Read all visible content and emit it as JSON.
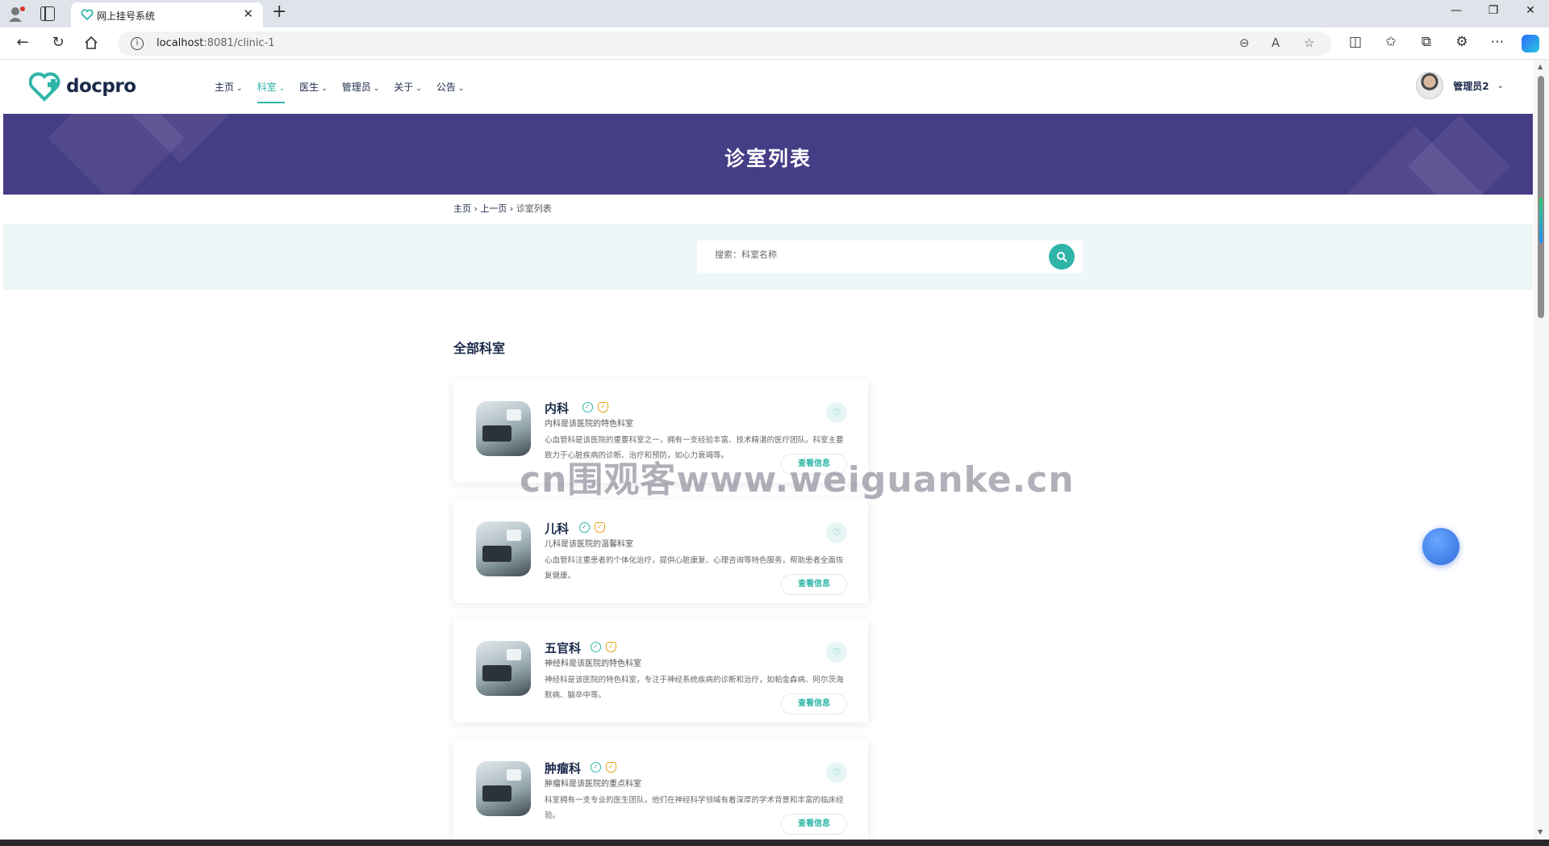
{
  "browser": {
    "tab_title": "网上挂号系统",
    "tab_close": "✕",
    "new_tab": "+",
    "url_host": "localhost",
    "url_rest": ":8081/clinic-1",
    "window_controls": [
      "—",
      "❐",
      "✕"
    ]
  },
  "header": {
    "logo_text": "docpro",
    "menu": [
      {
        "label": "主页",
        "active": false
      },
      {
        "label": "科室",
        "active": true
      },
      {
        "label": "医生",
        "active": false
      },
      {
        "label": "管理员",
        "active": false
      },
      {
        "label": "关于",
        "active": false
      },
      {
        "label": "公告",
        "active": false
      }
    ],
    "user_name": "管理员2"
  },
  "banner": {
    "title": "诊室列表"
  },
  "breadcrumb": {
    "home": "主页",
    "prev": "上一页",
    "current": "诊室列表",
    "sep": "›"
  },
  "search": {
    "placeholder": "搜索：科室名称"
  },
  "section": {
    "title": "全部科室"
  },
  "cards": [
    {
      "name": "内科",
      "subtitle": "内科是该医院的特色科室",
      "description": "心血管科是该医院的重要科室之一，拥有一支经验丰富、技术精湛的医疗团队。科室主要致力于心脏疾病的诊断、治疗和预防，如心力衰竭等。",
      "more": "查看信息"
    },
    {
      "name": "儿科",
      "subtitle": "儿科是该医院的温馨科室",
      "description": "心血管科注重患者的个体化治疗，提供心脏康复、心理咨询等特色服务，帮助患者全面恢复健康。",
      "more": "查看信息"
    },
    {
      "name": "五官科",
      "subtitle": "神经科是该医院的特色科室",
      "description": "神经科是该医院的特色科室，专注于神经系统疾病的诊断和治疗，如帕金森病、阿尔茨海默病、脑卒中等。",
      "more": "查看信息"
    },
    {
      "name": "肿瘤科",
      "subtitle": "肿瘤科是该医院的重点科室",
      "description": "科室拥有一支专业的医生团队，他们在神经科学领域有着深厚的学术背景和丰富的临床经验。",
      "more": "查看信息"
    }
  ],
  "watermark": "cn围观客www.weiguanke.cn",
  "colors": {
    "primary": "#2fb5a8",
    "banner": "#453d85",
    "text": "#1b2a4a",
    "search_band": "#edf7f7"
  }
}
